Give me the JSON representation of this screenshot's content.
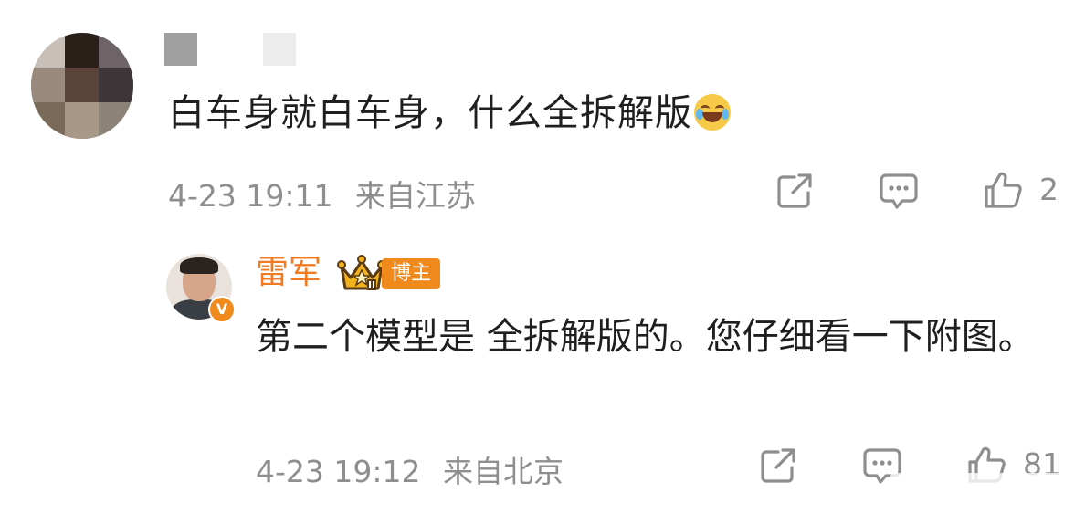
{
  "comment": {
    "text": "白车身就白车身，什么全拆解版",
    "emoji_icon": "laughing-crying-face",
    "time": "4-23 19:11",
    "location": "来自江苏",
    "likes": "2"
  },
  "reply": {
    "username": "雷军",
    "badge": "博主",
    "verified_mark": "V",
    "text": "第二个模型是 全拆解版的。您仔细看一下附图。",
    "time": "4-23 19:12",
    "location": "来自北京",
    "likes": "81"
  },
  "colors": {
    "accent": "#f07b22",
    "meta": "#8e8e8e"
  }
}
